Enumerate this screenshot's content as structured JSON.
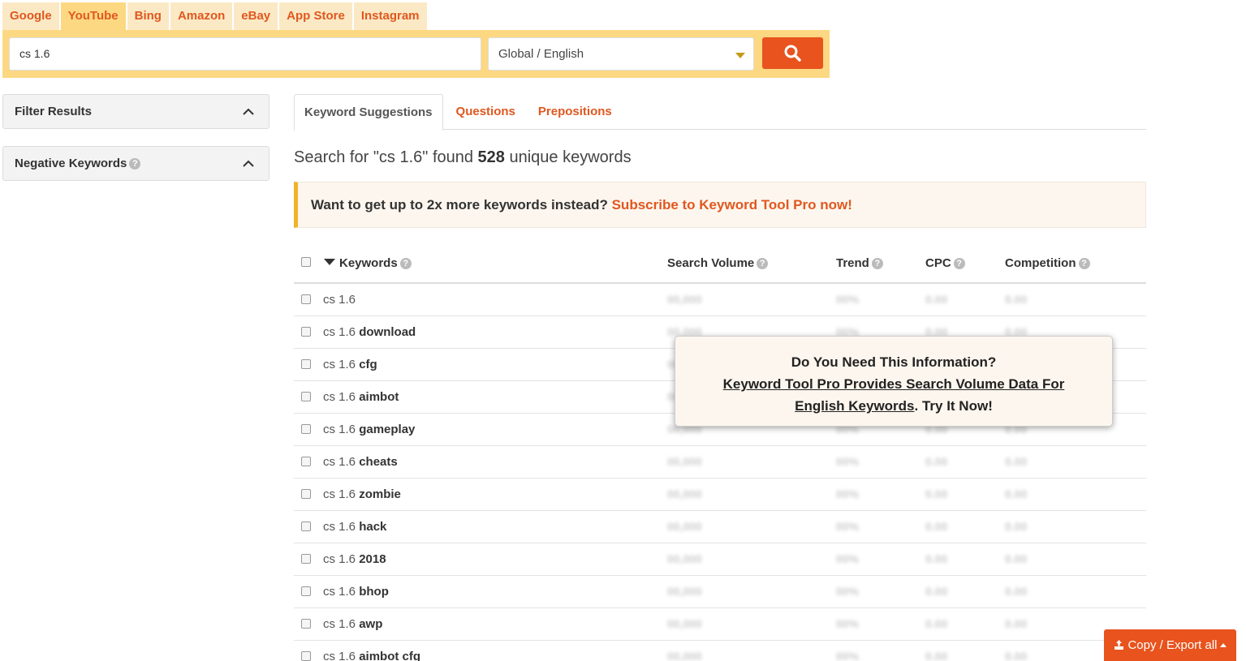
{
  "engines": [
    {
      "label": "Google",
      "active": false
    },
    {
      "label": "YouTube",
      "active": true
    },
    {
      "label": "Bing",
      "active": false
    },
    {
      "label": "Amazon",
      "active": false
    },
    {
      "label": "eBay",
      "active": false
    },
    {
      "label": "App Store",
      "active": false
    },
    {
      "label": "Instagram",
      "active": false
    }
  ],
  "search": {
    "value": "cs 1.6",
    "language": "Global / English"
  },
  "sidebar": {
    "filter_label": "Filter Results",
    "negative_label": "Negative Keywords"
  },
  "result_tabs": [
    "Keyword Suggestions",
    "Questions",
    "Prepositions"
  ],
  "found": {
    "prefix": "Search for \"cs 1.6\" found ",
    "count": "528",
    "suffix": " unique keywords"
  },
  "promo": {
    "text": "Want to get up to 2x more keywords instead? ",
    "link": "Subscribe to Keyword Tool Pro now!"
  },
  "table": {
    "headers": {
      "keywords": "Keywords",
      "volume": "Search Volume",
      "trend": "Trend",
      "cpc": "CPC",
      "competition": "Competition"
    },
    "base": "cs 1.6",
    "rows": [
      "",
      "download",
      "cfg",
      "aimbot",
      "gameplay",
      "cheats",
      "zombie",
      "hack",
      "2018",
      "bhop",
      "awp",
      "aimbot cfg"
    ],
    "placeholder": {
      "volume": "00,000",
      "trend": "00%",
      "cpc": "0.00",
      "competition": "0.00"
    }
  },
  "popup": {
    "line1": "Do You Need This Information?",
    "link": "Keyword Tool Pro Provides Search Volume Data For English Keywords",
    "tail": ". Try It Now!"
  },
  "export": {
    "label": "Copy / Export all"
  }
}
